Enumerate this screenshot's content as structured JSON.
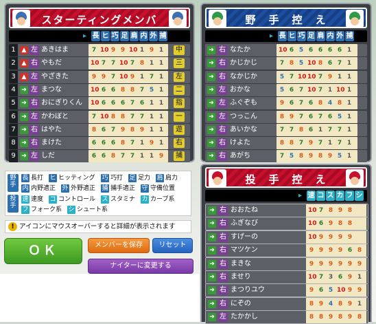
{
  "starting": {
    "title": "スターティングメンバー",
    "headers": [
      "長",
      "ヒ",
      "巧",
      "足",
      "肩",
      "内",
      "外",
      "捕"
    ],
    "rows": [
      {
        "n": "1",
        "icon": "up",
        "hand": "左",
        "name": "あきはま",
        "vals": [
          "7",
          "10",
          "9",
          "9",
          "10",
          "1",
          "9",
          "1"
        ],
        "pos": "中"
      },
      {
        "n": "2",
        "icon": "up",
        "hand": "右",
        "name": "やもだ",
        "vals": [
          "10",
          "7",
          "7",
          "10",
          "7",
          "8",
          "1",
          "1"
        ],
        "pos": "三"
      },
      {
        "n": "3",
        "icon": "up",
        "hand": "左",
        "name": "やざきた",
        "vals": [
          "9",
          "9",
          "7",
          "10",
          "9",
          "1",
          "7",
          "1"
        ],
        "pos": "左"
      },
      {
        "n": "4",
        "icon": "arrow",
        "hand": "左",
        "name": "まつな",
        "vals": [
          "10",
          "6",
          "6",
          "8",
          "8",
          "7",
          "5",
          "1"
        ],
        "pos": "二"
      },
      {
        "n": "5",
        "icon": "arrow",
        "hand": "右",
        "name": "おにぎりくん",
        "vals": [
          "10",
          "6",
          "6",
          "6",
          "7",
          "6",
          "1",
          "1"
        ],
        "pos": "指"
      },
      {
        "n": "6",
        "icon": "arrow",
        "hand": "左",
        "name": "かわぼと",
        "vals": [
          "7",
          "10",
          "8",
          "8",
          "7",
          "7",
          "1",
          "1"
        ],
        "pos": "一"
      },
      {
        "n": "7",
        "icon": "arrow",
        "hand": "右",
        "name": "はやた",
        "vals": [
          "8",
          "6",
          "7",
          "9",
          "8",
          "9",
          "1",
          "1"
        ],
        "pos": "遊"
      },
      {
        "n": "8",
        "icon": "arrow",
        "hand": "右",
        "name": "まけた",
        "vals": [
          "6",
          "6",
          "6",
          "8",
          "7",
          "1",
          "9",
          "1"
        ],
        "pos": "右"
      },
      {
        "n": "9",
        "icon": "arrow",
        "hand": "左",
        "name": "しだ",
        "vals": [
          "6",
          "6",
          "8",
          "7",
          "7",
          "1",
          "1",
          "9"
        ],
        "pos": "捕"
      }
    ]
  },
  "fielders": {
    "title": "野　手　控　え",
    "headers": [
      "長",
      "ヒ",
      "巧",
      "足",
      "肩",
      "内",
      "外",
      "捕"
    ],
    "rows": [
      {
        "hand": "右",
        "name": "なたか",
        "vals": [
          "10",
          "6",
          "5",
          "6",
          "6",
          "6",
          "6",
          "1"
        ]
      },
      {
        "hand": "右",
        "name": "かじかじ",
        "vals": [
          "7",
          "8",
          "5",
          "10",
          "8",
          "6",
          "7",
          "1"
        ]
      },
      {
        "hand": "右",
        "name": "なかじか",
        "vals": [
          "5",
          "7",
          "10",
          "10",
          "7",
          "9",
          "1",
          "1"
        ]
      },
      {
        "hand": "左",
        "name": "おかな",
        "vals": [
          "5",
          "6",
          "7",
          "10",
          "7",
          "1",
          "10",
          "1"
        ]
      },
      {
        "hand": "左",
        "name": "ふぐぞも",
        "vals": [
          "9",
          "6",
          "7",
          "6",
          "8",
          "4",
          "8",
          "1"
        ]
      },
      {
        "hand": "左",
        "name": "つっこん",
        "vals": [
          "8",
          "9",
          "7",
          "6",
          "7",
          "6",
          "5",
          "1"
        ]
      },
      {
        "hand": "右",
        "name": "あいかな",
        "vals": [
          "7",
          "7",
          "8",
          "6",
          "1",
          "7",
          "7",
          "1"
        ]
      },
      {
        "hand": "右",
        "name": "けよた",
        "vals": [
          "8",
          "8",
          "7",
          "9",
          "7",
          "1",
          "7",
          "1"
        ]
      },
      {
        "hand": "右",
        "name": "あがち",
        "vals": [
          "7",
          "5",
          "8",
          "9",
          "8",
          "9",
          "5",
          "1"
        ]
      }
    ]
  },
  "pitchers": {
    "title": "投　手　控　え",
    "headers": [
      "速",
      "コ",
      "ス",
      "カ",
      "フ",
      "シ"
    ],
    "rows": [
      {
        "hand": "右",
        "name": "おおたね",
        "vals": [
          "10",
          "7",
          "8",
          "9",
          "8",
          ""
        ]
      },
      {
        "hand": "右",
        "name": "ふぎなび",
        "vals": [
          "10",
          "6",
          "9",
          "8",
          "8",
          ""
        ]
      },
      {
        "hand": "右",
        "name": "すげーの",
        "vals": [
          "10",
          "9",
          "9",
          "9",
          "9",
          ""
        ]
      },
      {
        "hand": "右",
        "name": "マツケン",
        "vals": [
          "9",
          "9",
          "9",
          "9",
          "6",
          "8"
        ]
      },
      {
        "hand": "右",
        "name": "まきな",
        "vals": [
          "9",
          "9",
          "9",
          "9",
          "9",
          "9"
        ]
      },
      {
        "hand": "右",
        "name": "ませり",
        "vals": [
          "10",
          "7",
          "3",
          "6",
          "9",
          "1"
        ]
      },
      {
        "hand": "右",
        "name": "まつりユウ",
        "vals": [
          "9",
          "6",
          "5",
          "10",
          "9",
          "9"
        ]
      },
      {
        "hand": "右",
        "name": "にぞの",
        "vals": [
          "8",
          "9",
          "4",
          "8",
          "9",
          "1"
        ]
      },
      {
        "hand": "左",
        "name": "たかかし",
        "vals": [
          "8",
          "8",
          "9",
          "8",
          "9",
          "8"
        ]
      }
    ]
  },
  "legend": {
    "fielder_tag": "野手",
    "pitcher_tag": "投手",
    "row1": [
      [
        "長",
        "長打"
      ],
      [
        "ヒ",
        "ヒッティング"
      ],
      [
        "巧",
        "巧打"
      ],
      [
        "足",
        "足力"
      ],
      [
        "肩",
        "肩力"
      ]
    ],
    "row2": [
      [
        "内",
        "内野適正"
      ],
      [
        "外",
        "外野適正"
      ],
      [
        "捕",
        "捕手適正"
      ],
      [
        "守",
        "守備位置"
      ]
    ],
    "row3": [
      [
        "速",
        "速度"
      ],
      [
        "コ",
        "コントロール"
      ],
      [
        "ス",
        "スタミナ"
      ],
      [
        "カ",
        "カーブ系"
      ]
    ],
    "row4": [
      [
        "フ",
        "フォーク系"
      ],
      [
        "シ",
        "シュート系"
      ]
    ]
  },
  "info": "アイコンにマウスオーバーすると詳細が表示されます",
  "buttons": {
    "ok": "ＯＫ",
    "save": "メンバーを保存",
    "reset": "リセット",
    "night": "ナイターに変更する"
  },
  "colors": {
    "header_red": "#c8102e",
    "header_blue": "#1d4fa0",
    "stat_bg": "#f1e7c2",
    "ok_green": "#4ca52a",
    "save_orange": "#e97a1c",
    "reset_blue": "#2f6fcc",
    "night_purple": "#8a4bb5"
  }
}
